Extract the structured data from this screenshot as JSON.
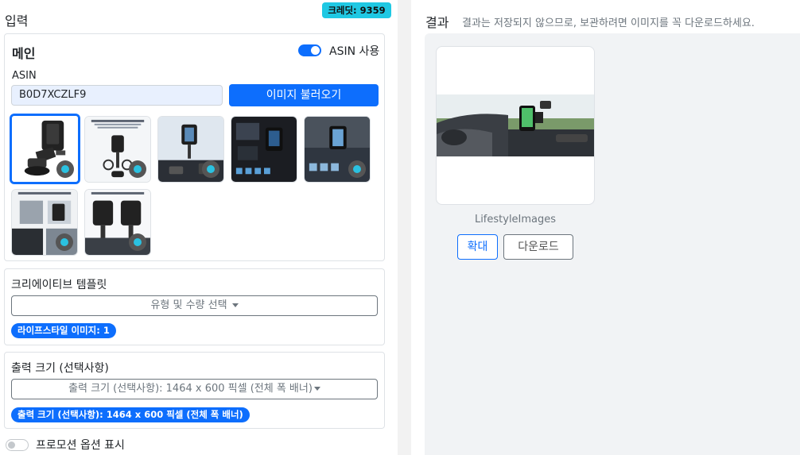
{
  "left_panel": {
    "title": "입력",
    "credit": "크레딧: 9359",
    "main": {
      "title": "메인",
      "asin_toggle_label": "ASIN 사용",
      "asin_toggle_on": true,
      "asin_label": "ASIN",
      "asin_value": "B0D7XCZLF9",
      "load_button": "이미지 불러오기",
      "thumbnails": [
        {
          "name": "product-main",
          "selected": true
        },
        {
          "name": "product-features",
          "selected": false
        },
        {
          "name": "product-dashboard",
          "selected": false
        },
        {
          "name": "product-dark-interior",
          "selected": false
        },
        {
          "name": "product-rain",
          "selected": false
        },
        {
          "name": "product-stability",
          "selected": false
        },
        {
          "name": "product-duo",
          "selected": false
        }
      ]
    },
    "template": {
      "title": "크리에이티브 템플릿",
      "dropdown_placeholder": "유형 및 수량 선택",
      "tag": "라이프스타일 이미지: 1"
    },
    "size": {
      "title": "출력 크기 (선택사항)",
      "dropdown_value": "출력 크기 (선택사항): 1464 x 600 픽셀 (전체 폭 배너)",
      "tag": "출력 크기 (선택사항): 1464 x 600 픽셀 (전체 폭 배너)"
    },
    "promo_label": "프로모션 옵션 표시",
    "promo_toggle_on": false
  },
  "right_panel": {
    "title": "결과",
    "subtitle": "결과는 저장되지 않으므로, 보관하려면 이미지를 꼭 다운로드하세요.",
    "result": {
      "caption": "LifestyleImages",
      "zoom_button": "확대",
      "download_button": "다운로드"
    }
  },
  "colors": {
    "primary": "#0d6efd",
    "credit_bg": "#1fc8e3"
  }
}
